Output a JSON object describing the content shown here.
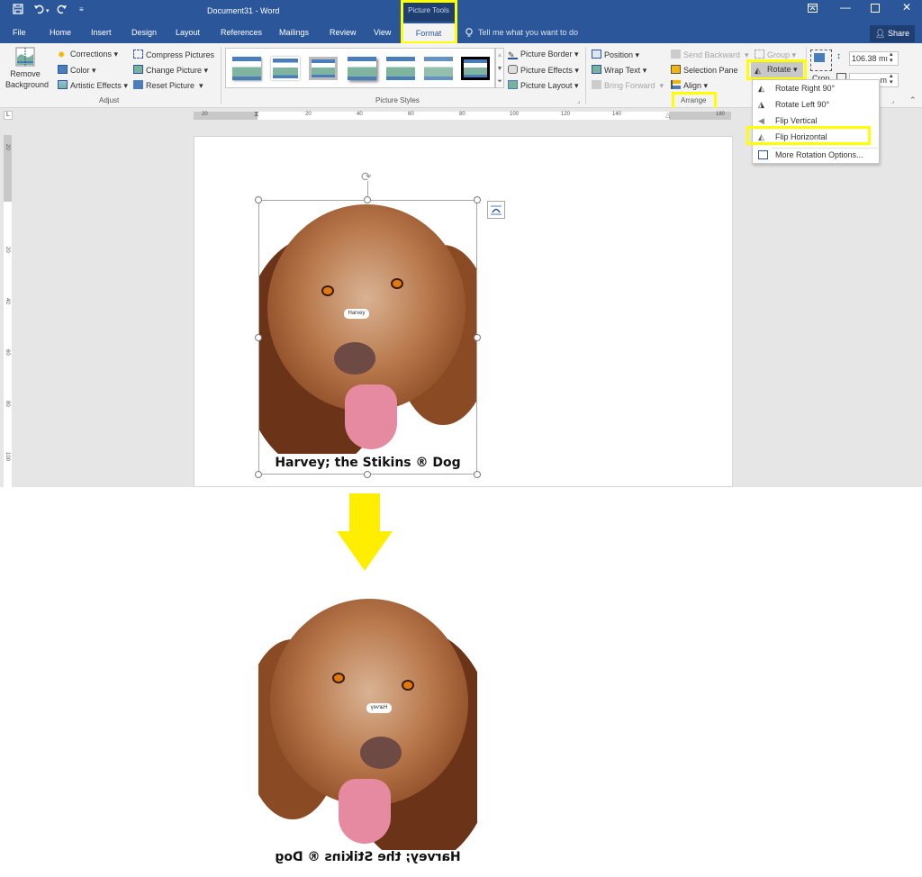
{
  "titlebar": {
    "doc_title": "Document31  -  Word",
    "context_header": "Picture Tools",
    "quick_access": [
      "save-icon",
      "undo-icon",
      "redo-icon",
      "customize-icon"
    ],
    "window_buttons": [
      "ribbon-display-options-icon",
      "minimize-icon",
      "maximize-icon",
      "close-icon"
    ]
  },
  "tabs": {
    "items": [
      "File",
      "Home",
      "Insert",
      "Design",
      "Layout",
      "References",
      "Mailings",
      "Review",
      "View"
    ],
    "active": "Format",
    "tell_me": "Tell me what you want to do",
    "share": "Share"
  },
  "ribbon": {
    "adjust": {
      "remove_background": [
        "Remove",
        "Background"
      ],
      "corrections": "Corrections",
      "color": "Color",
      "artistic_effects": "Artistic Effects",
      "compress": "Compress Pictures",
      "change_picture": "Change Picture",
      "reset_picture": "Reset Picture",
      "label": "Adjust"
    },
    "picture_styles": {
      "label": "Picture Styles",
      "style_count": 7,
      "picture_border": "Picture Border",
      "picture_effects": "Picture Effects",
      "picture_layout": "Picture Layout"
    },
    "arrange": {
      "position": "Position",
      "wrap_text": "Wrap Text",
      "bring_forward": "Bring Forward",
      "send_backward": "Send Backward",
      "selection_pane": "Selection Pane",
      "align": "Align",
      "group": "Group",
      "rotate": "Rotate",
      "label": "Arrange"
    },
    "size": {
      "crop": "Crop",
      "height": "106.38 mı",
      "width": "m"
    }
  },
  "rotate_menu": {
    "items": [
      {
        "label": "Rotate Right 90°",
        "icon": "rotate-right-icon"
      },
      {
        "label": "Rotate Left 90°",
        "icon": "rotate-left-icon"
      },
      {
        "label": "Flip Vertical",
        "icon": "flip-vertical-icon"
      },
      {
        "label": "Flip Horizontal",
        "icon": "flip-horizontal-icon",
        "highlighted": true
      },
      {
        "label": "More Rotation Options...",
        "icon": "rotation-options-icon"
      }
    ]
  },
  "rulers": {
    "horizontal": [
      "20",
      "20",
      "40",
      "60",
      "80",
      "100",
      "120",
      "140",
      "180"
    ],
    "vertical": [
      "20",
      "20",
      "40",
      "60",
      "80",
      "100"
    ]
  },
  "document": {
    "original_caption": "Harvey; the Stikins ® Dog",
    "name_tag": "Harvey"
  },
  "result": {
    "caption_mirrored": "Harvey; the Stikins ® Dog",
    "name_tag": "Harvey"
  },
  "colors": {
    "word_blue": "#2b579a",
    "highlight_yellow": "#ffff00",
    "arrow_yellow": "#ffee00"
  }
}
